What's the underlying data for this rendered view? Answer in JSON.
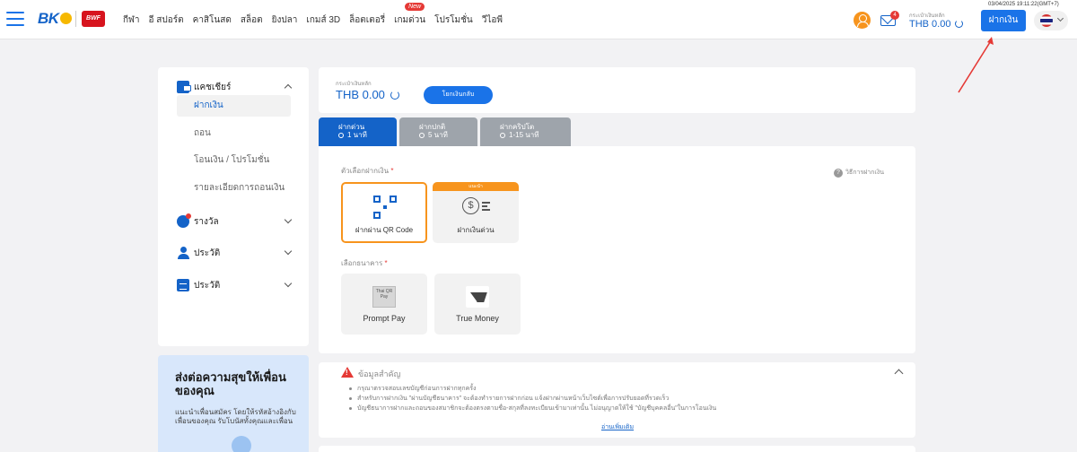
{
  "header": {
    "nav": [
      {
        "label": "กีฬา"
      },
      {
        "label": "อี สปอร์ต"
      },
      {
        "label": "คาสิโนสด"
      },
      {
        "label": "สล็อต"
      },
      {
        "label": "ยิงปลา"
      },
      {
        "label": "เกมส์ 3D"
      },
      {
        "label": "ล็อตเตอรี่"
      },
      {
        "label": "เกมด่วน",
        "badge": "New"
      },
      {
        "label": "โปรโมชั่น"
      },
      {
        "label": "วีไอพี"
      }
    ],
    "logo_brand": "BK8",
    "logo_partner": "BWF",
    "mail_count": "4",
    "wallet_label": "กระเป๋าเงินหลัก",
    "wallet_value": "THB 0.00",
    "datetime": "03/04/2025 19:11:22(GMT+7)",
    "deposit_label": "ฝากเงิน",
    "colors": {
      "accent": "#1a73e8",
      "brand": "#1463c8",
      "orange": "#f7941d",
      "red": "#e53935"
    }
  },
  "sidebar": {
    "sections": [
      {
        "label": "แคชเชียร์",
        "icon": "wallet-icon",
        "expanded": true
      },
      {
        "label": "รางวัล",
        "icon": "reward-icon",
        "expanded": false
      },
      {
        "label": "ประวัติ",
        "icon": "user-icon",
        "expanded": false
      },
      {
        "label": "ประวัติ",
        "icon": "document-icon",
        "expanded": false
      }
    ],
    "cashier_items": [
      {
        "label": "ฝากเงิน",
        "active": true
      },
      {
        "label": "ถอน"
      },
      {
        "label": "โอนเงิน / โปรโมชั่น"
      },
      {
        "label": "รายละเอียดการถอนเงิน"
      }
    ]
  },
  "promo": {
    "title": "ส่งต่อความสุขให้เพื่อนของคุณ",
    "desc": "แนะนำเพื่อนสมัคร โดยให้รหัสอ้างอิงกับเพื่อนของคุณ รับโบนัสทั้งคุณและเพื่อน"
  },
  "main_wallet": {
    "label": "กระเป๋าเงินหลัก",
    "value": "THB 0.00",
    "transfer_label": "โยกเงินกลับ"
  },
  "tabs": [
    {
      "title": "ฝากด่วน",
      "time": "1 นาที",
      "active": true
    },
    {
      "title": "ฝากปกติ",
      "time": "5 นาที"
    },
    {
      "title": "ฝากคริปโต",
      "time": "1-15 นาที"
    }
  ],
  "deposit": {
    "options_label": "ตัวเลือกฝากเงิน",
    "howto": "วิธีการฝากเงิน",
    "options": [
      {
        "label": "ฝากผ่าน QR Code",
        "icon": "qr-code-icon",
        "selected": true
      },
      {
        "label": "ฝากเงินด่วน",
        "icon": "cash-icon",
        "tag": "แนะนำ"
      }
    ],
    "bank_label": "เลือกธนาคาร",
    "banks": [
      {
        "label": "Prompt Pay",
        "icon": "promptpay-logo",
        "logo_text": "Thai QR Pay"
      },
      {
        "label": "True Money",
        "icon": "truemoney-logo"
      }
    ]
  },
  "info": {
    "title": "ข้อมูลสำคัญ",
    "items": [
      "กรุณาตรวจสอบเลขบัญชีก่อนการฝากทุกครั้ง",
      "สำหรับการฝากเงิน \"ผ่านบัญชีธนาคาร\" จะต้องทำรายการฝากก่อน แจ้งฝากผ่านหน้าเว็บไซต์เพื่อการปรับยอดที่รวดเร็ว",
      "บัญชีธนาการฝากและถอนของสมาชิกจะต้องตรงตามชื่อ-สกุลที่ลงทะเบียนเข้ามาเท่านั้น ไม่อนุญาตให้ใช้ \"บัญชีบุคคลอื่น\"ในการโอนเงิน"
    ],
    "read_more": "อ่านเพิ่มเติม"
  }
}
